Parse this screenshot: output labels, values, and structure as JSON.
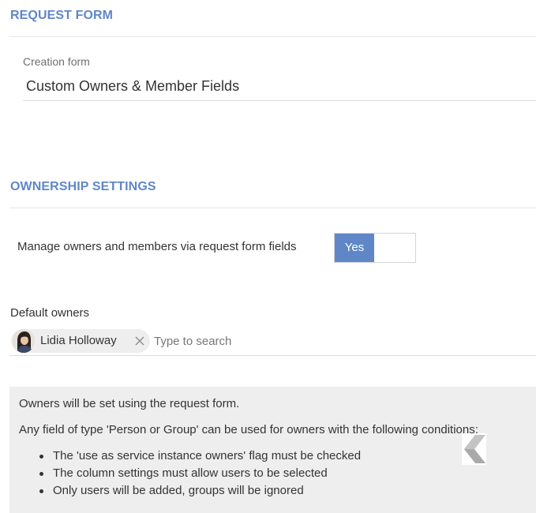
{
  "request_form": {
    "title": "REQUEST FORM",
    "creation_form_label": "Creation form",
    "creation_form_value": "Custom Owners & Member Fields"
  },
  "ownership_settings": {
    "title": "OWNERSHIP SETTINGS",
    "manage_label": "Manage owners and members via request form fields",
    "toggle_value": "Yes",
    "default_owners_label": "Default owners",
    "owners": [
      {
        "name": "Lidia Holloway"
      }
    ],
    "search_placeholder": "Type to search"
  },
  "info": {
    "line1": "Owners will be set using the request form.",
    "line2": "Any field of type 'Person or Group' can be used for owners with the following conditions:",
    "conditions": [
      "The 'use as service instance owners' flag must be checked",
      "The column settings must allow users to be selected",
      "Only users will be added, groups will be ignored"
    ]
  },
  "colors": {
    "accent": "#5f87c8",
    "info_background": "#eeeeee"
  }
}
